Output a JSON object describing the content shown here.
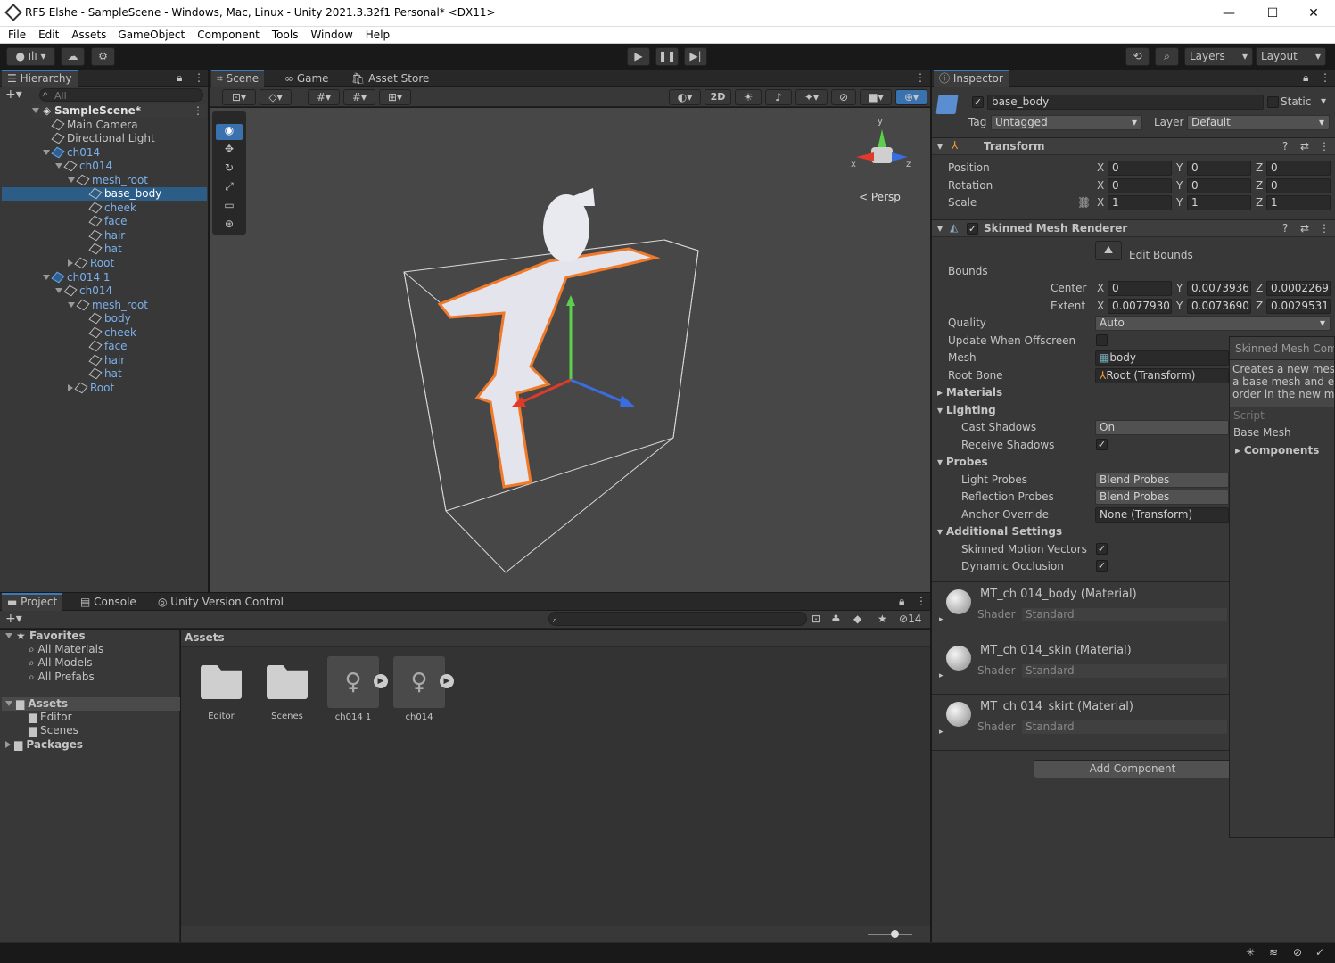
{
  "window": {
    "title": "RF5 Elshe - SampleScene - Windows, Mac, Linux - Unity 2021.3.32f1 Personal* <DX11>",
    "min": "—",
    "max": "☐",
    "close": "✕"
  },
  "menu": [
    "File",
    "Edit",
    "Assets",
    "GameObject",
    "Component",
    "Tools",
    "Window",
    "Help"
  ],
  "toolbar": {
    "layers": "Layers",
    "layout": "Layout"
  },
  "hierarchy": {
    "tab": "Hierarchy",
    "search_placeholder": "All",
    "items": [
      {
        "label": "SampleScene*"
      },
      {
        "label": "Main Camera"
      },
      {
        "label": "Directional Light"
      },
      {
        "label": "ch014"
      },
      {
        "label": "ch014"
      },
      {
        "label": "mesh_root"
      },
      {
        "label": "base_body"
      },
      {
        "label": "cheek"
      },
      {
        "label": "face"
      },
      {
        "label": "hair"
      },
      {
        "label": "hat"
      },
      {
        "label": "Root"
      },
      {
        "label": "ch014 1"
      },
      {
        "label": "ch014"
      },
      {
        "label": "mesh_root"
      },
      {
        "label": "body"
      },
      {
        "label": "cheek"
      },
      {
        "label": "face"
      },
      {
        "label": "hair"
      },
      {
        "label": "hat"
      },
      {
        "label": "Root"
      }
    ]
  },
  "scene": {
    "tabs": [
      "Scene",
      "Game",
      "Asset Store"
    ],
    "mode_2d": "2D",
    "persp": "Persp",
    "gizmo": {
      "y": "y",
      "x": "x",
      "z": "z"
    }
  },
  "project": {
    "tabs": [
      "Project",
      "Console",
      "Unity Version Control"
    ],
    "hidden_count": "14",
    "favorites": {
      "title": "Favorites",
      "items": [
        "All Materials",
        "All Models",
        "All Prefabs"
      ]
    },
    "tree": {
      "assets": "Assets",
      "editor": "Editor",
      "scenes": "Scenes",
      "packages": "Packages"
    },
    "breadcrumb": "Assets",
    "assets": [
      {
        "label": "Editor"
      },
      {
        "label": "Scenes"
      },
      {
        "label": "ch014 1"
      },
      {
        "label": "ch014"
      }
    ]
  },
  "inspector": {
    "tab": "Inspector",
    "name": "base_body",
    "static": "Static",
    "tag_label": "Tag",
    "tag": "Untagged",
    "layer_label": "Layer",
    "layer": "Default",
    "transform": {
      "title": "Transform",
      "rows": [
        {
          "label": "Position",
          "x": "0",
          "y": "0",
          "z": "0"
        },
        {
          "label": "Rotation",
          "x": "0",
          "y": "0",
          "z": "0"
        },
        {
          "label": "Scale",
          "x": "1",
          "y": "1",
          "z": "1"
        }
      ]
    },
    "smr": {
      "title": "Skinned Mesh Renderer",
      "edit_bounds": "Edit Bounds",
      "bounds": "Bounds",
      "center": {
        "label": "Center",
        "x": "0",
        "y": "0.0073936",
        "z": "0.0002269"
      },
      "extent": {
        "label": "Extent",
        "x": "0.0077930",
        "y": "0.0073690",
        "z": "0.0029531"
      },
      "quality_label": "Quality",
      "quality": "Auto",
      "update_offscreen": "Update When Offscreen",
      "mesh_label": "Mesh",
      "mesh": "body",
      "root_bone_label": "Root Bone",
      "root_bone": "Root (Transform)",
      "materials": "Materials",
      "lighting": "Lighting",
      "cast_shadows_label": "Cast Shadows",
      "cast_shadows": "On",
      "receive_shadows": "Receive Shadows",
      "probes": "Probes",
      "light_probes_label": "Light Probes",
      "light_probes": "Blend Probes",
      "reflection_probes_label": "Reflection Probes",
      "reflection_probes": "Blend Probes",
      "anchor_override_label": "Anchor Override",
      "anchor_override": "None (Transform)",
      "additional": "Additional Settings",
      "motion_vectors": "Skinned Motion Vectors",
      "dynamic_occlusion": "Dynamic Occlusion"
    },
    "materials": [
      {
        "name": "MT_ch 014_body (Material)",
        "shader_label": "Shader",
        "shader": "Standard"
      },
      {
        "name": "MT_ch 014_skin (Material)",
        "shader_label": "Shader",
        "shader": "Standard"
      },
      {
        "name": "MT_ch 014_skirt (Material)",
        "shader_label": "Shader",
        "shader": "Standard"
      }
    ],
    "add_component": "Add Component"
  },
  "tooltip": {
    "title": "Skinned Mesh Compo",
    "desc1": "Creates a new mesh",
    "desc2": "a base mesh and en",
    "desc3": "order in the new me",
    "script": "Script",
    "base_mesh": "Base Mesh",
    "components": "Components"
  }
}
